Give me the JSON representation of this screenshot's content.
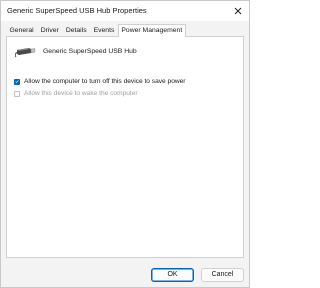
{
  "window": {
    "title": "Generic SuperSpeed USB Hub Properties"
  },
  "tabs": [
    {
      "label": "General"
    },
    {
      "label": "Driver"
    },
    {
      "label": "Details"
    },
    {
      "label": "Events"
    },
    {
      "label": "Power Management",
      "active": true
    }
  ],
  "device": {
    "name": "Generic SuperSpeed USB Hub",
    "icon": "usb-hub-icon"
  },
  "options": {
    "allow_turn_off": {
      "label": "Allow the computer to turn off this device to save power",
      "checked": true,
      "enabled": true
    },
    "allow_wake": {
      "label": "Allow this device to wake the computer",
      "checked": false,
      "enabled": false
    }
  },
  "buttons": {
    "ok": "OK",
    "cancel": "Cancel"
  },
  "colors": {
    "accent": "#0067c0",
    "disabled_text": "#9e9e9e"
  }
}
